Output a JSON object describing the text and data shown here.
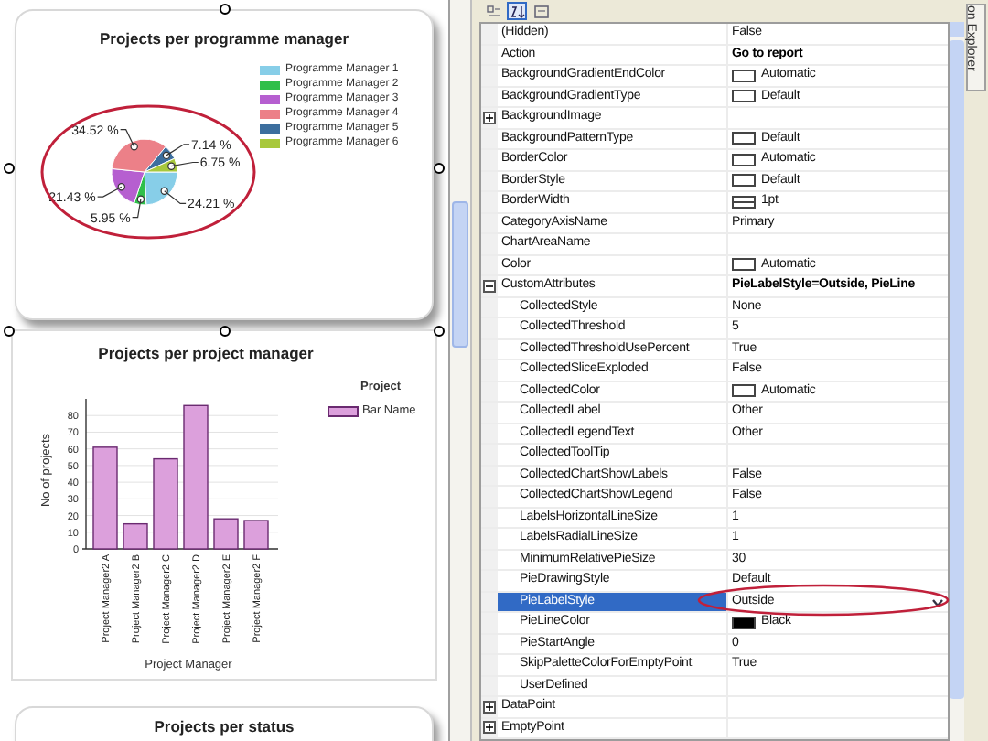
{
  "designer": {
    "pie_chart": {
      "slices": [
        {
          "color": "#87cee8"
        },
        {
          "color": "#2fbf4a"
        },
        {
          "color": "#b65fd0"
        },
        {
          "color": "#ec8088"
        },
        {
          "color": "#3c6e9e"
        },
        {
          "color": "#a8c83c"
        }
      ],
      "chart_data": {
        "type": "pie",
        "title": "Projects per programme manager",
        "legend": true,
        "categories": [
          "Programme Manager 1",
          "Programme Manager 2",
          "Programme Manager 3",
          "Programme Manager 4",
          "Programme Manager 5",
          "Programme Manager 6"
        ],
        "values": [
          24.21,
          5.95,
          21.43,
          34.52,
          7.14,
          6.75
        ],
        "value_labels": [
          "24.21 %",
          "5.95 %",
          "21.43 %",
          "34.52 %",
          "7.14 %",
          "6.75 %"
        ]
      }
    },
    "bar_chart": {
      "chart_data": {
        "type": "bar",
        "title": "Projects per project manager",
        "xlabel": "Project Manager",
        "ylabel": "No of projects",
        "legend": {
          "title": "Project"
        },
        "grid": true,
        "categories": [
          "Project Manager2 A",
          "Project Manager2 B",
          "Project Manager2 C",
          "Project Manager2 D",
          "Project Manager2 E",
          "Project Manager2 F"
        ],
        "series": [
          {
            "name": "Bar Name",
            "color": "#dca0dc",
            "values": [
              61,
              15,
              54,
              86,
              18,
              17
            ]
          }
        ],
        "ylim": [
          0,
          90
        ],
        "yticks": [
          {
            "value": 0,
            "label": "0"
          },
          {
            "value": 10,
            "label": "10"
          },
          {
            "value": 20,
            "label": "20"
          },
          {
            "value": 30,
            "label": "30"
          },
          {
            "value": 40,
            "label": "40"
          },
          {
            "value": 50,
            "label": "50"
          },
          {
            "value": 60,
            "label": "60"
          },
          {
            "value": 70,
            "label": "70"
          },
          {
            "value": 80,
            "label": "80"
          }
        ]
      }
    },
    "status_chart": {
      "title": "Projects per status"
    }
  },
  "property_grid": {
    "toolbar": [
      {
        "kind": "categorized",
        "selected": false
      },
      {
        "kind": "alphabetical",
        "selected": true
      },
      {
        "kind": "pages",
        "selected": false
      }
    ],
    "properties": [
      {
        "name": "(Hidden)",
        "value": "False",
        "selected": false
      },
      {
        "name": "Action",
        "value": "Go to report",
        "bold": true,
        "selected": false
      },
      {
        "name": "BackgroundGradientEndColor",
        "value": "Automatic",
        "kind": "color",
        "color": "#ffffff",
        "selected": false
      },
      {
        "name": "BackgroundGradientType",
        "value": "Default",
        "kind": "color",
        "color": "#ffffff",
        "selected": false
      },
      {
        "name": "BackgroundImage",
        "expanded": false,
        "selected": false
      },
      {
        "name": "BackgroundPatternType",
        "value": "Default",
        "kind": "color",
        "color": "#ffffff",
        "selected": false
      },
      {
        "name": "BorderColor",
        "value": "Automatic",
        "kind": "color",
        "color": "#ffffff",
        "selected": false
      },
      {
        "name": "BorderStyle",
        "value": "Default",
        "kind": "color",
        "color": "#ffffff",
        "selected": false
      },
      {
        "name": "BorderWidth",
        "value": "1pt",
        "kind": "line",
        "selected": false
      },
      {
        "name": "CategoryAxisName",
        "value": "Primary",
        "selected": false
      },
      {
        "name": "ChartAreaName",
        "selected": false
      },
      {
        "name": "Color",
        "value": "Automatic",
        "kind": "color",
        "color": "#ffffff",
        "selected": false
      },
      {
        "name": "CustomAttributes",
        "value": "PieLabelStyle=Outside, PieLine",
        "bold": true,
        "expanded": true,
        "selected": false,
        "children": [
          {
            "name": "CollectedStyle",
            "value": "None",
            "selected": false
          },
          {
            "name": "CollectedThreshold",
            "value": "5",
            "selected": false
          },
          {
            "name": "CollectedThresholdUsePercent",
            "value": "True",
            "selected": false
          },
          {
            "name": "CollectedSliceExploded",
            "value": "False",
            "selected": false
          },
          {
            "name": "CollectedColor",
            "value": "Automatic",
            "kind": "color",
            "color": "#ffffff",
            "selected": false
          },
          {
            "name": "CollectedLabel",
            "value": "Other",
            "selected": false
          },
          {
            "name": "CollectedLegendText",
            "value": "Other",
            "selected": false
          },
          {
            "name": "CollectedToolTip",
            "selected": false
          },
          {
            "name": "CollectedChartShowLabels",
            "value": "False",
            "selected": false
          },
          {
            "name": "CollectedChartShowLegend",
            "value": "False",
            "selected": false
          },
          {
            "name": "LabelsHorizontalLineSize",
            "value": "1",
            "selected": false
          },
          {
            "name": "LabelsRadialLineSize",
            "value": "1",
            "selected": false
          },
          {
            "name": "MinimumRelativePieSize",
            "value": "30",
            "selected": false
          },
          {
            "name": "PieDrawingStyle",
            "value": "Default",
            "selected": false
          },
          {
            "name": "PieLabelStyle",
            "value": "Outside",
            "selected": true
          },
          {
            "name": "PieLineColor",
            "value": "Black",
            "kind": "color",
            "color": "#000000",
            "selected": false
          },
          {
            "name": "PieStartAngle",
            "value": "0",
            "selected": false
          },
          {
            "name": "SkipPaletteColorForEmptyPoint",
            "value": "True",
            "selected": false
          },
          {
            "name": "UserDefined",
            "selected": false
          }
        ]
      },
      {
        "name": "DataPoint",
        "expanded": false,
        "selected": false
      },
      {
        "name": "EmptyPoint",
        "expanded": false,
        "selected": false
      }
    ]
  },
  "side_tab": "on Explorer"
}
